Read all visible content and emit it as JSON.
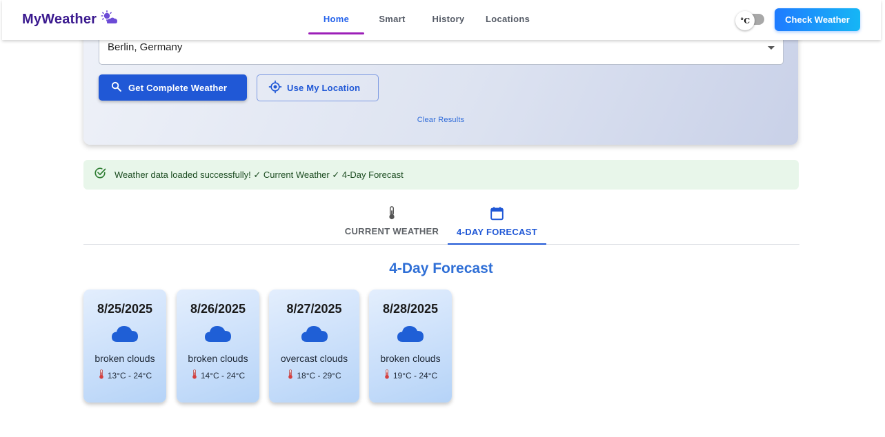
{
  "app": {
    "brand": "MyWeather",
    "brand_icon": "cloud-sun-icon",
    "nav": [
      {
        "label": "Home",
        "active": true
      },
      {
        "label": "Smart",
        "active": false
      },
      {
        "label": "History",
        "active": false
      },
      {
        "label": "Locations",
        "active": false
      }
    ],
    "unit_toggle": "°C",
    "check_button": "Check Weather"
  },
  "search": {
    "location_value": "Berlin, Germany",
    "get_button": "Get Complete Weather",
    "location_button": "Use My Location",
    "clear_link": "Clear Results"
  },
  "alert": {
    "text": "Weather data loaded successfully! ✓ Current Weather ✓ 4-Day Forecast",
    "icon": "check-circle-icon",
    "color": "#e8f6ea"
  },
  "tabs": [
    {
      "label": "CURRENT WEATHER",
      "icon": "thermometer-icon",
      "active": false
    },
    {
      "label": "4-DAY FORECAST",
      "icon": "calendar-icon",
      "active": true
    }
  ],
  "forecast": {
    "title": "4-Day Forecast",
    "days": [
      {
        "date": "8/25/2025",
        "description": "broken clouds",
        "temp": "13°C - 24°C",
        "icon": "cloud-icon"
      },
      {
        "date": "8/26/2025",
        "description": "broken clouds",
        "temp": "14°C - 24°C",
        "icon": "cloud-icon"
      },
      {
        "date": "8/27/2025",
        "description": "overcast clouds",
        "temp": "18°C - 29°C",
        "icon": "cloud-icon"
      },
      {
        "date": "8/28/2025",
        "description": "broken clouds",
        "temp": "19°C - 24°C",
        "icon": "cloud-icon"
      }
    ]
  },
  "colors": {
    "accent": "#2058d6",
    "brand": "#3b1a8f",
    "nav_underline": "#9c1fb8",
    "success_bg": "#e8f6ea"
  }
}
